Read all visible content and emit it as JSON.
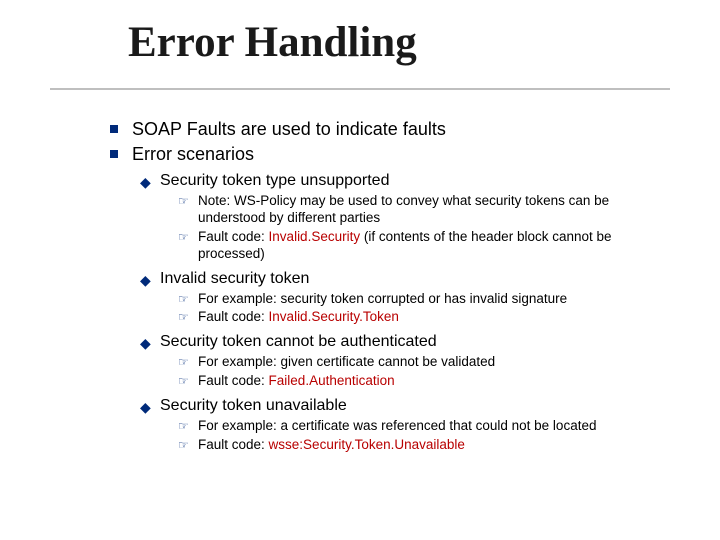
{
  "title": "Error Handling",
  "top": {
    "line1": "SOAP Faults are used to indicate faults",
    "line2": "Error scenarios"
  },
  "scenarios": [
    {
      "heading": "Security token type unsupported",
      "detail": "Note: WS-Policy may be used to convey what security tokens can be understood by different parties",
      "fc_label": "Fault code: ",
      "fc_value": "Invalid.Security",
      "fc_tail": " (if contents of the header block cannot be processed)"
    },
    {
      "heading": "Invalid security token",
      "detail": "For example: security token corrupted or has invalid signature",
      "fc_label": "Fault code: ",
      "fc_value": "Invalid.Security.Token",
      "fc_tail": ""
    },
    {
      "heading": "Security token cannot be authenticated",
      "detail": "For example: given certificate cannot be validated",
      "fc_label": "Fault code: ",
      "fc_value": "Failed.Authentication",
      "fc_tail": ""
    },
    {
      "heading": "Security token unavailable",
      "detail": "For example: a certificate was referenced that could not be located",
      "fc_label": "Fault code: ",
      "fc_value": "wsse:Security.Token.Unavailable",
      "fc_tail": ""
    }
  ]
}
